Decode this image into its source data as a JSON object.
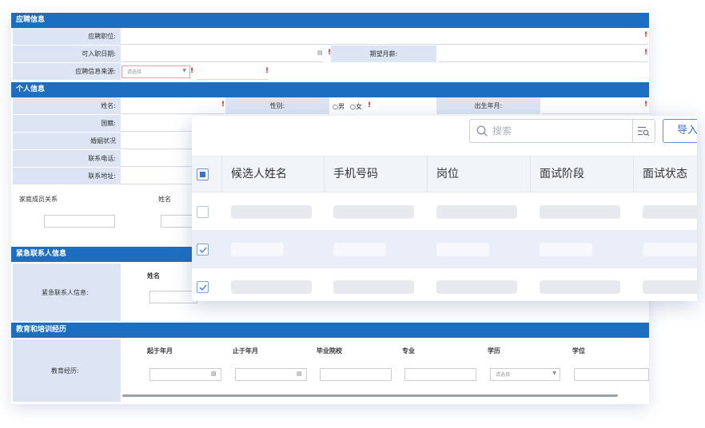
{
  "form": {
    "sections": {
      "application": "应聘信息",
      "personal": "个人信息",
      "emergency": "紧急联系人信息",
      "education": "教育和培训经历"
    },
    "application": {
      "position_label": "应聘职位:",
      "start_date_label": "可入职日期:",
      "expected_salary_label": "期望月薪:",
      "source_label": "应聘信息来源:",
      "source_placeholder": "请选择"
    },
    "personal": {
      "name_label": "姓名:",
      "gender_label": "性别:",
      "gender_male": "男",
      "gender_female": "女",
      "birth_label": "出生年月:",
      "nationality_label": "国籍:",
      "marital_label": "婚姻状况",
      "phone_label": "联系电话:",
      "address_label": "联系地址:",
      "family_relation_header": "家庭成员关系",
      "family_name_header": "姓名"
    },
    "emergency": {
      "label": "紧急联系人信息:",
      "name_header": "姓名"
    },
    "education": {
      "label": "教育经历:",
      "headers": [
        "起于年月",
        "止于年月",
        "毕业院校",
        "专业",
        "学历",
        "学位"
      ],
      "degree_placeholder": "请选择"
    },
    "required_mark": "!"
  },
  "table": {
    "search_placeholder": "搜索",
    "import_label": "导入",
    "columns": [
      "候选人姓名",
      "手机号码",
      "岗位",
      "面试阶段",
      "面试状态"
    ],
    "rows": [
      {
        "checked": false
      },
      {
        "checked": true
      },
      {
        "checked": true
      }
    ],
    "header_checkbox_state": "partial"
  },
  "colors": {
    "section_header": "#1c6fc0",
    "label_bg": "#dde5f4",
    "required": "#e02020",
    "accent": "#2f6fd6",
    "selected_row": "#e9eef9"
  },
  "icons": {
    "search": "search-icon",
    "filter": "filter-search-icon",
    "calendar": "calendar-icon",
    "checkbox": "checkbox-check-icon"
  }
}
